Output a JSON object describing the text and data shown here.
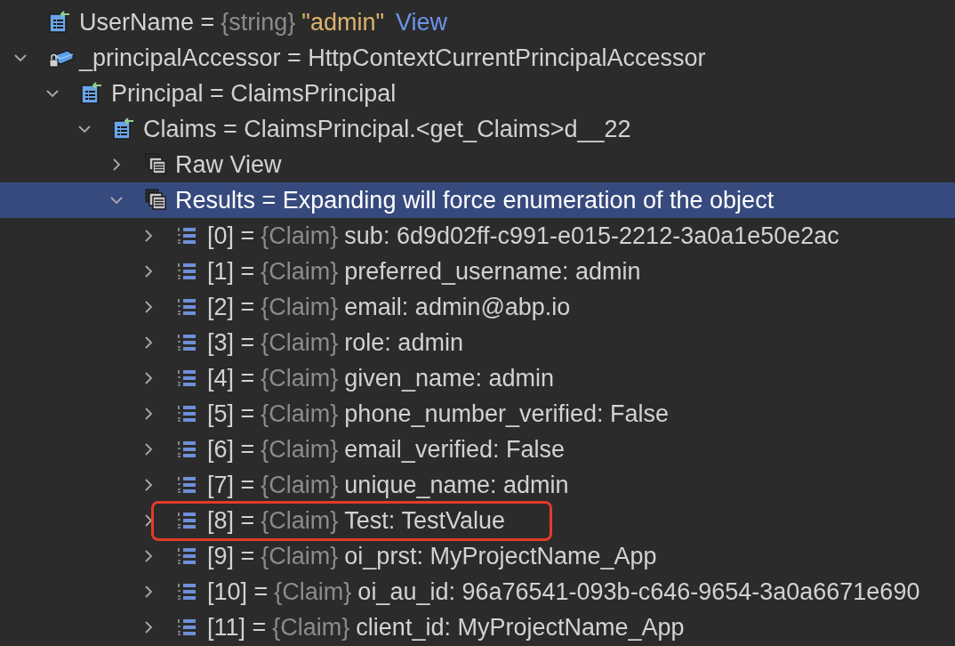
{
  "tree": [
    {
      "kind": "string-field",
      "label": "UserName =",
      "type": "{string}",
      "value": "\"admin\"",
      "link": "View",
      "selected": false
    },
    {
      "kind": "locked-field",
      "label": "_principalAccessor = HttpContextCurrentPrincipalAccessor",
      "expanded": true,
      "selected": false,
      "children": [
        {
          "kind": "field",
          "label": "Principal = ClaimsPrincipal",
          "expanded": true,
          "selected": false,
          "children": [
            {
              "kind": "field",
              "label": "Claims = ClaimsPrincipal.<get_Claims>d__22",
              "expanded": true,
              "selected": false,
              "children": [
                {
                  "kind": "raw-view",
                  "label": "Raw View",
                  "expanded": false,
                  "selected": false
                },
                {
                  "kind": "raw-view",
                  "label": "Results = Expanding will force enumeration of the object",
                  "expanded": true,
                  "selected": true,
                  "children": [
                    {
                      "kind": "list-item",
                      "label": "[0] =",
                      "type": "{Claim}",
                      "value": "sub: 6d9d02ff-c991-e015-2212-3a0a1e50e2ac",
                      "expanded": false,
                      "selected": false,
                      "annotated": false
                    },
                    {
                      "kind": "list-item",
                      "label": "[1] =",
                      "type": "{Claim}",
                      "value": "preferred_username: admin",
                      "expanded": false,
                      "selected": false,
                      "annotated": false
                    },
                    {
                      "kind": "list-item",
                      "label": "[2] =",
                      "type": "{Claim}",
                      "value": "email: admin@abp.io",
                      "expanded": false,
                      "selected": false,
                      "annotated": false
                    },
                    {
                      "kind": "list-item",
                      "label": "[3] =",
                      "type": "{Claim}",
                      "value": "role: admin",
                      "expanded": false,
                      "selected": false,
                      "annotated": false
                    },
                    {
                      "kind": "list-item",
                      "label": "[4] =",
                      "type": "{Claim}",
                      "value": "given_name: admin",
                      "expanded": false,
                      "selected": false,
                      "annotated": false
                    },
                    {
                      "kind": "list-item",
                      "label": "[5] =",
                      "type": "{Claim}",
                      "value": "phone_number_verified: False",
                      "expanded": false,
                      "selected": false,
                      "annotated": false
                    },
                    {
                      "kind": "list-item",
                      "label": "[6] =",
                      "type": "{Claim}",
                      "value": "email_verified: False",
                      "expanded": false,
                      "selected": false,
                      "annotated": false
                    },
                    {
                      "kind": "list-item",
                      "label": "[7] =",
                      "type": "{Claim}",
                      "value": "unique_name: admin",
                      "expanded": false,
                      "selected": false,
                      "annotated": false
                    },
                    {
                      "kind": "list-item",
                      "label": "[8] =",
                      "type": "{Claim}",
                      "value": "Test: TestValue",
                      "expanded": false,
                      "selected": false,
                      "annotated": true
                    },
                    {
                      "kind": "list-item",
                      "label": "[9] =",
                      "type": "{Claim}",
                      "value": "oi_prst: MyProjectName_App",
                      "expanded": false,
                      "selected": false,
                      "annotated": false
                    },
                    {
                      "kind": "list-item",
                      "label": "[10] =",
                      "type": "{Claim}",
                      "value": "oi_au_id: 96a76541-093b-c646-9654-3a0a6671e690",
                      "expanded": false,
                      "selected": false,
                      "annotated": false
                    },
                    {
                      "kind": "list-item",
                      "label": "[11] =",
                      "type": "{Claim}",
                      "value": "client_id: MyProjectName_App",
                      "expanded": false,
                      "selected": false,
                      "annotated": false
                    }
                  ]
                }
              ]
            }
          ]
        }
      ]
    }
  ]
}
